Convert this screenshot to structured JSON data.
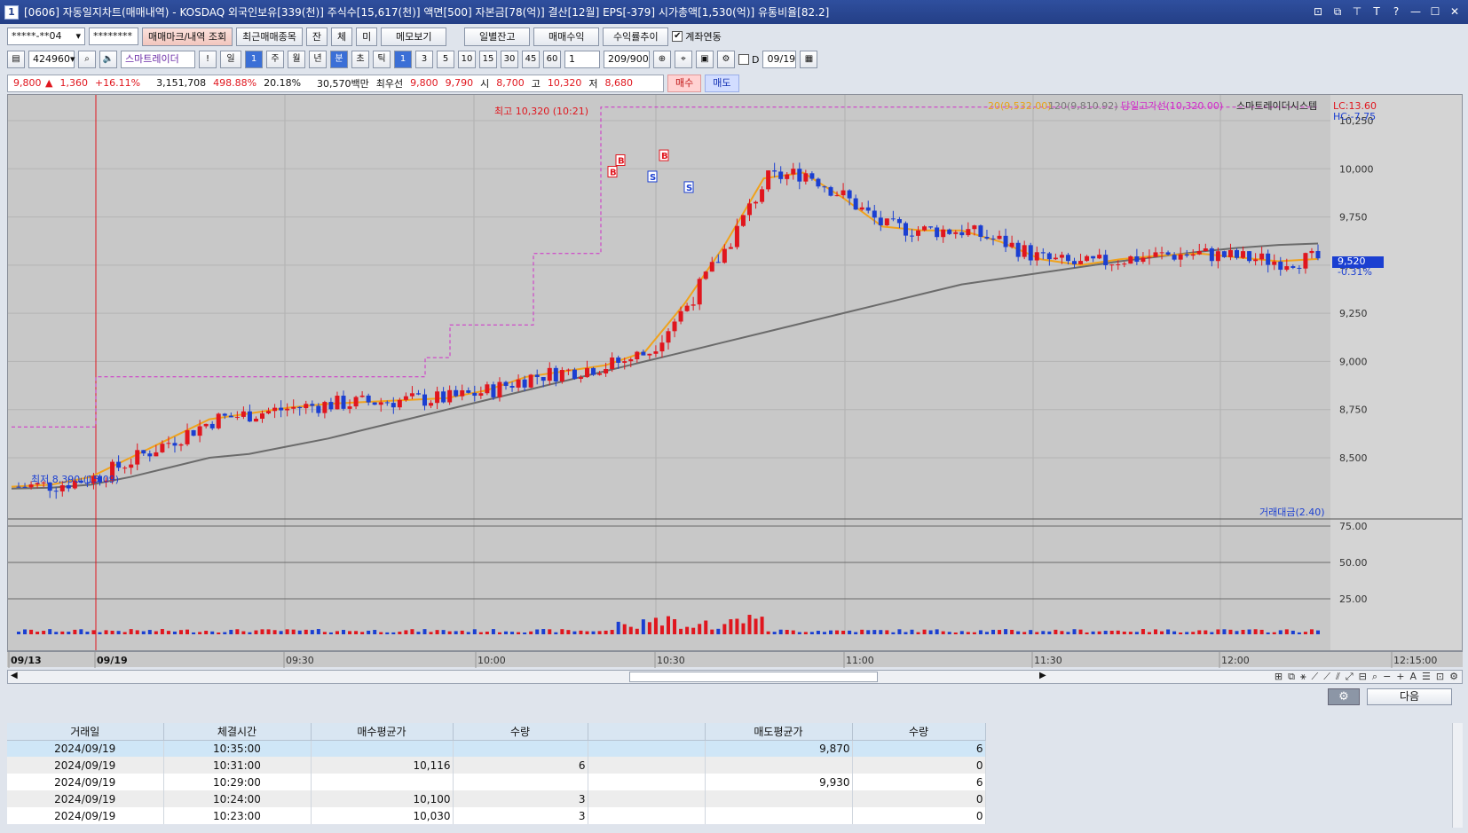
{
  "window": {
    "number": "1",
    "title": "[0606] 자동일지차트(매매내역) - KOSDAQ 외국인보유[339(천)] 주식수[15,617(천)] 액면[500] 자본금[78(억)] 결산[12월] EPS[-379] 시가총액[1,530(억)] 유통비율[82.2]",
    "controls": [
      "⊡",
      "⧉",
      "⊤",
      "T",
      "?",
      "—",
      "☐",
      "✕"
    ]
  },
  "toolbar1": {
    "account": "*****-**04",
    "password": "********",
    "buttons": [
      "매매마크/내역 조회",
      "최근매매종목",
      "잔",
      "체",
      "미",
      "메모보기",
      "일별잔고",
      "매매수익",
      "수익률추이"
    ],
    "linked_label": "계좌연동",
    "linked_checked": "✔"
  },
  "toolbar2": {
    "stock_code": "424960",
    "stock_name": "스마트레이더",
    "alert": "!",
    "period_buttons": [
      "일",
      "1",
      "주",
      "월",
      "년",
      "분",
      "초",
      "틱"
    ],
    "interval_buttons": [
      "1",
      "3",
      "5",
      "10",
      "15",
      "30",
      "45",
      "60"
    ],
    "interval_value": "1",
    "count": "209/900",
    "date": "09/19",
    "d_label": "D"
  },
  "quote": {
    "price": "9,800",
    "change_arrow": "▲",
    "change": "1,360",
    "change_pct": "+16.11%",
    "volume": "3,151,708",
    "vol_ratio": "498.88%",
    "turnover": "20.18%",
    "amount": "30,570백만",
    "best_label": "최우선",
    "ask": "9,800",
    "bid": "9,790",
    "open_label": "시",
    "open": "8,700",
    "high_label": "고",
    "high": "10,320",
    "low_label": "저",
    "low": "8,680",
    "buy_btn": "매수",
    "sell_btn": "매도"
  },
  "chart_labels": {
    "ma20": "20(9,532.00)",
    "ma120": "120(9,810.92)",
    "high_line": "당일고가선(10,320.00)",
    "stock_label": "스마트레이더시스템",
    "lc": "LC:13.60",
    "hc": "HC:-7.75",
    "high_marker": "최고 10,320 (10:21)",
    "low_marker": "최저 8,390 (15:09)",
    "current_price": "9,520",
    "current_pct": "-0.31%",
    "volume_label": "거래대금(2.40)",
    "buy_mark": "B",
    "sell_mark": "S"
  },
  "chart_data": {
    "type": "candlestick",
    "price_axis_ticks": [
      "10,250",
      "10,000",
      "9,750",
      "9,500",
      "9,250",
      "9,000",
      "8,750",
      "8,500"
    ],
    "volume_axis_ticks": [
      "75.00",
      "50.00",
      "25.00"
    ],
    "time_axis_ticks": [
      "09/13",
      "09/19",
      "09:30",
      "10:00",
      "10:30",
      "11:00",
      "11:30",
      "12:00",
      "12:15:00"
    ],
    "price_range": [
      8300,
      10400
    ],
    "day_high": 10320,
    "day_low": 8680,
    "last": 9520,
    "series": [
      {
        "name": "20",
        "values": [
          8350,
          8360,
          8400,
          8500,
          8600,
          8700,
          8730,
          8760,
          8780,
          8790,
          8800,
          8810,
          8850,
          8920,
          8950,
          8980,
          9050,
          9300,
          9600,
          9950,
          9980,
          9850,
          9700,
          9680,
          9680,
          9620,
          9530,
          9500,
          9530,
          9550,
          9560,
          9540,
          9520,
          9532
        ]
      },
      {
        "name": "120",
        "values": [
          8340,
          8345,
          8360,
          8400,
          8450,
          8500,
          8520,
          8560,
          8600,
          8650,
          8700,
          8750,
          8800,
          8850,
          8900,
          8950,
          9000,
          9050,
          9100,
          9150,
          9200,
          9250,
          9300,
          9350,
          9400,
          9430,
          9460,
          9490,
          9520,
          9545,
          9570,
          9590,
          9605,
          9612
        ]
      }
    ]
  },
  "scroll_tools": [
    "⊞",
    "⧉",
    "⚹",
    "⟋",
    "⟋",
    "⫽",
    "⤢",
    "⊟",
    "⌕",
    "−",
    "+",
    "A",
    "☰",
    "⊡",
    "⚙"
  ],
  "grid": {
    "gear": "⚙",
    "next": "다음",
    "headers": [
      "거래일",
      "체결시간",
      "매수평균가",
      "수량",
      "",
      "매도평균가",
      "수량"
    ],
    "rows": [
      [
        "2024/09/19",
        "10:35:00",
        "",
        "",
        "",
        "9,870",
        "6"
      ],
      [
        "2024/09/19",
        "10:31:00",
        "10,116",
        "6",
        "",
        "",
        "0"
      ],
      [
        "2024/09/19",
        "10:29:00",
        "",
        "",
        "",
        "9,930",
        "6"
      ],
      [
        "2024/09/19",
        "10:24:00",
        "10,100",
        "3",
        "",
        "",
        "0"
      ],
      [
        "2024/09/19",
        "10:23:00",
        "10,030",
        "3",
        "",
        "",
        "0"
      ]
    ]
  }
}
